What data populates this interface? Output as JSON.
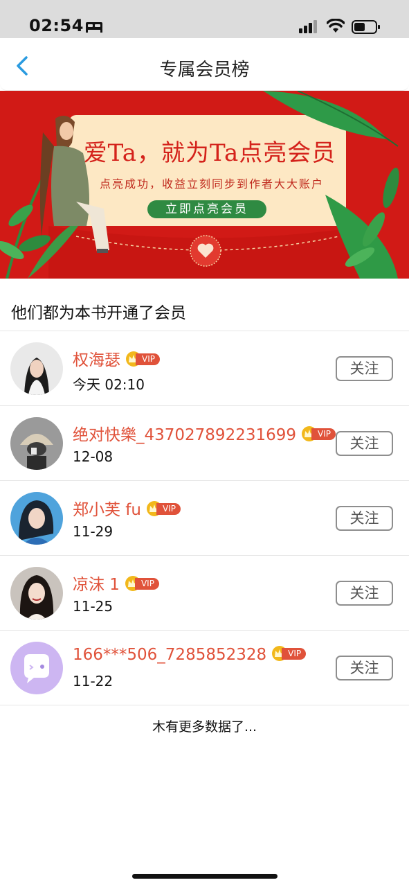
{
  "status_bar": {
    "time": "02:54"
  },
  "nav": {
    "title": "专属会员榜",
    "back_icon": "chevron-left-icon"
  },
  "banner": {
    "headline": "爱Ta，就为Ta点亮会员",
    "subtitle": "点亮成功，收益立刻同步到作者大大账户",
    "cta_label": "立即点亮会员"
  },
  "section": {
    "title": "他们都为本书开通了会员"
  },
  "members": [
    {
      "name": "权海瑟",
      "badge": "VIP",
      "time": "今天 02:10",
      "follow_label": "关注"
    },
    {
      "name": "绝对快樂_437027892231699",
      "badge": "VIP",
      "time": "12-08",
      "follow_label": "关注"
    },
    {
      "name": "郑小芙 fu",
      "badge": "VIP",
      "time": "11-29",
      "follow_label": "关注"
    },
    {
      "name": "凉沫 1",
      "badge": "VIP",
      "time": "11-25",
      "follow_label": "关注"
    },
    {
      "name": "166***506_7285852328",
      "badge": "VIP",
      "time": "11-22",
      "follow_label": "关注"
    }
  ],
  "footer": {
    "end_text": "木有更多数据了..."
  },
  "colors": {
    "accent": "#e0523a",
    "banner_red": "#d11a16",
    "cta_green": "#2f8a42",
    "vip_gold": "#f2b81b"
  }
}
